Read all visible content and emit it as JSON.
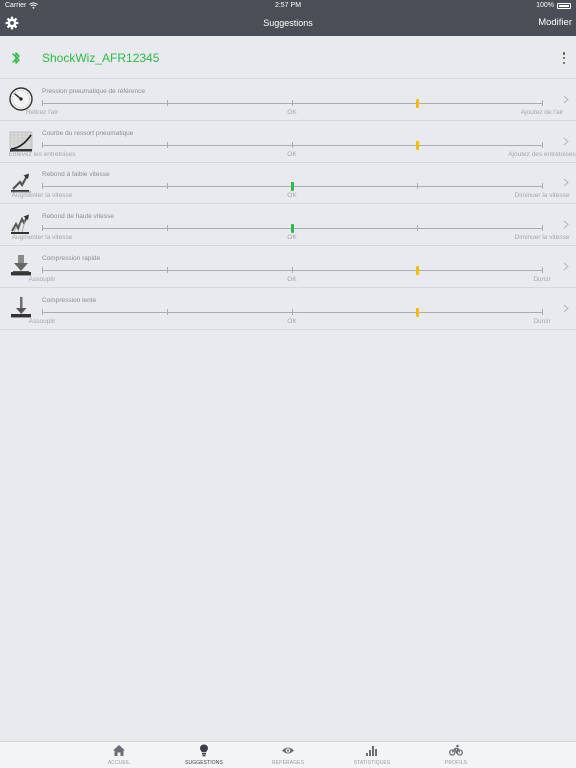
{
  "status_bar": {
    "carrier": "Carrier",
    "time": "2:57 PM",
    "battery": "100%"
  },
  "nav": {
    "title": "Suggestions",
    "right_button": "Modifier",
    "left_icon": "gear-icon"
  },
  "device": {
    "name": "ShockWiz_AFR12345",
    "icon": "bluetooth-icon"
  },
  "colors": {
    "accent_green": "#2fb94a",
    "marker_yellow": "#f5bd00",
    "marker_green": "#2fb94a",
    "bar_dark": "#4a4e57"
  },
  "settings": [
    {
      "title": "Pression pneumatique de référence",
      "left": "Retirez l'air",
      "mid": "OK",
      "right": "Ajoutez de l'air",
      "level_percent": 75,
      "marker_color": "yellow",
      "icon": "pressure-gauge-icon"
    },
    {
      "title": "Courbe du ressort pneumatique",
      "left": "Enlevez les entretoises",
      "mid": "OK",
      "right": "Ajoutez des entretoises",
      "level_percent": 75,
      "marker_color": "yellow",
      "icon": "spring-curve-icon"
    },
    {
      "title": "Rebond à faible vitesse",
      "left": "Augmenter la vitesse",
      "mid": "OK",
      "right": "Diminuer la vitesse",
      "level_percent": 50,
      "marker_color": "green",
      "icon": "low-speed-rebound-icon"
    },
    {
      "title": "Rebond de haute vitesse",
      "left": "Augmenter la vitesse",
      "mid": "OK",
      "right": "Diminuer la vitesse",
      "level_percent": 50,
      "marker_color": "green",
      "icon": "high-speed-rebound-icon"
    },
    {
      "title": "Compression rapide",
      "left": "Assouplir",
      "mid": "OK",
      "right": "Durcir",
      "level_percent": 75,
      "marker_color": "yellow",
      "icon": "fast-compression-icon"
    },
    {
      "title": "Compression lente",
      "left": "Assouplir",
      "mid": "OK",
      "right": "Durcir",
      "level_percent": 75,
      "marker_color": "yellow",
      "icon": "slow-compression-icon"
    }
  ],
  "tabs": [
    {
      "label": "ACCUEIL",
      "icon": "home-icon",
      "active": false
    },
    {
      "label": "SUGGESTIONS",
      "icon": "lightbulb-icon",
      "active": true
    },
    {
      "label": "REPÈRAGES",
      "icon": "eye-icon",
      "active": false
    },
    {
      "label": "STATISTIQUES",
      "icon": "bar-chart-icon",
      "active": false
    },
    {
      "label": "PROFILS",
      "icon": "bike-icon",
      "active": false
    }
  ]
}
